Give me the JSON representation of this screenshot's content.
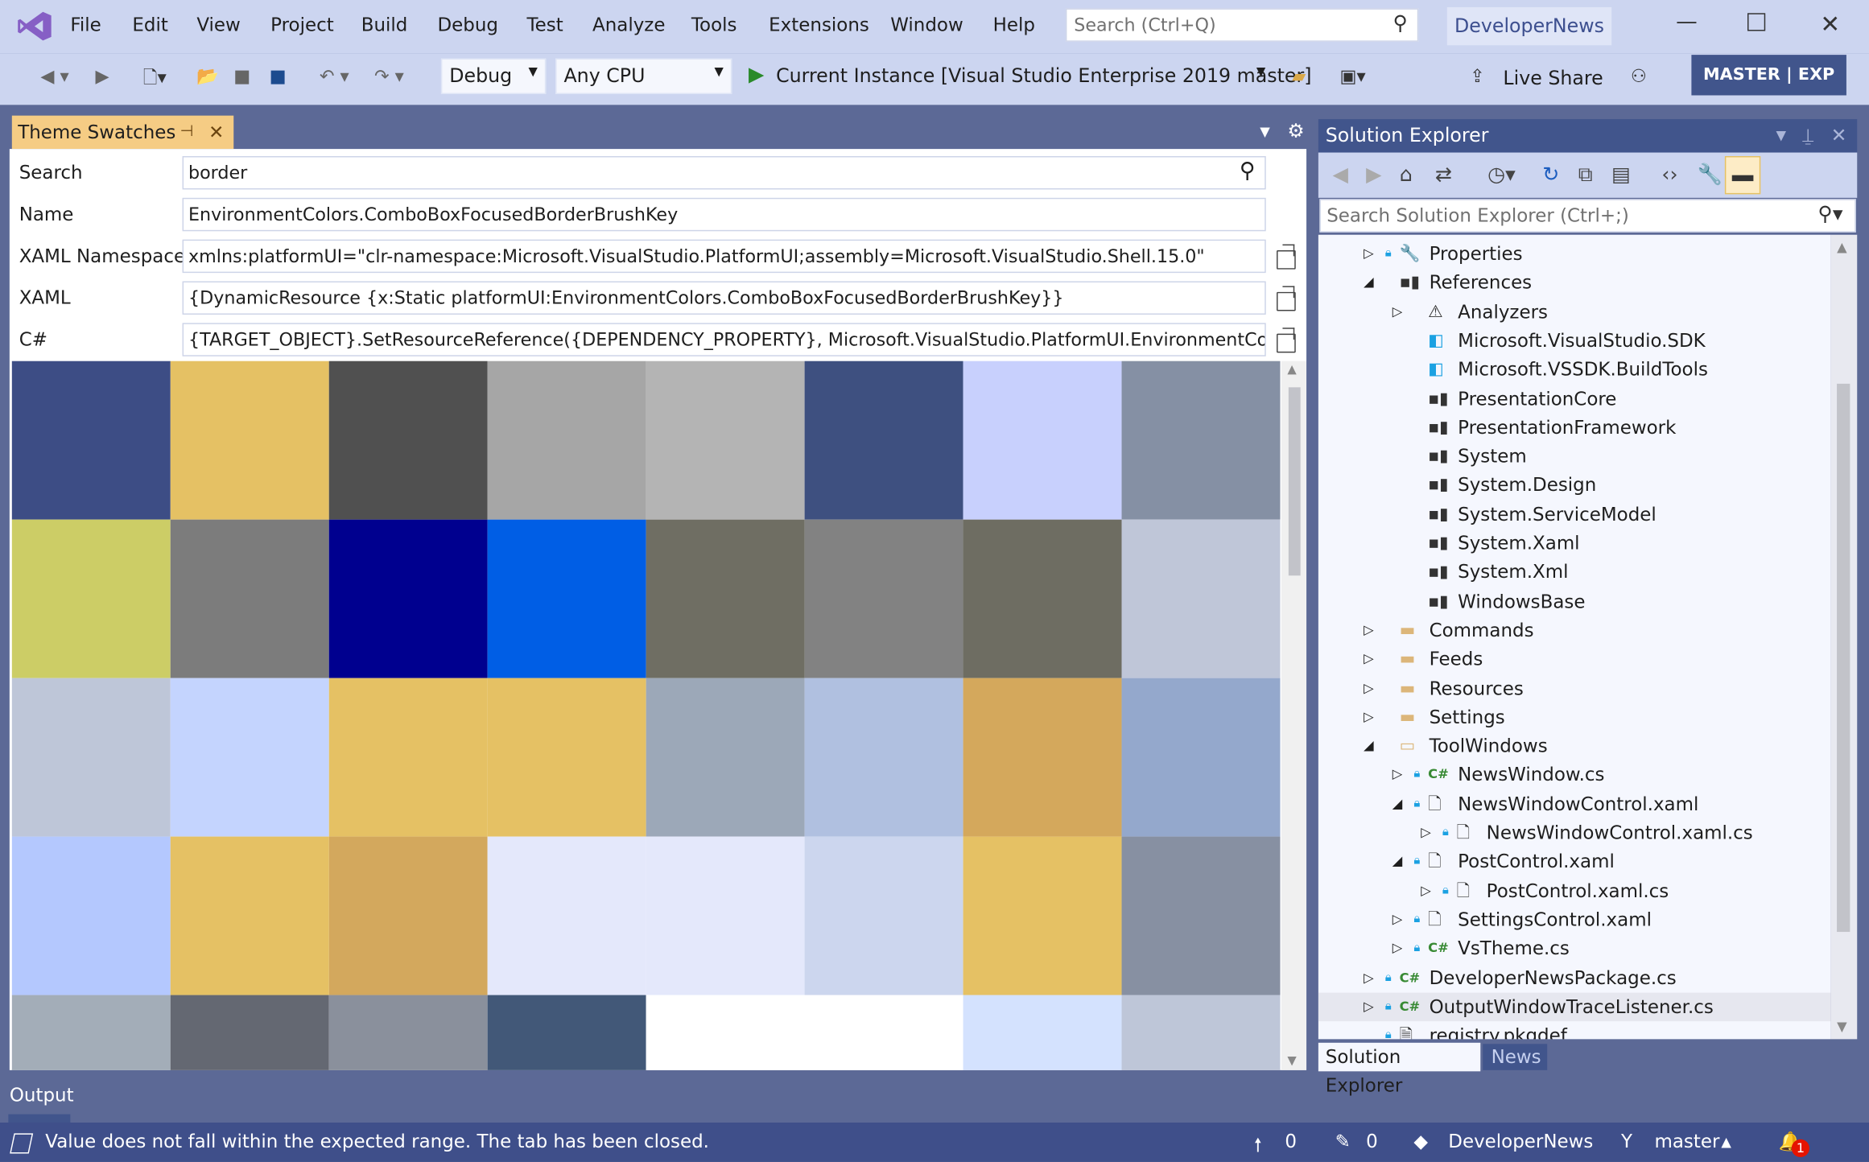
{
  "menu": [
    "File",
    "Edit",
    "View",
    "Project",
    "Build",
    "Debug",
    "Test",
    "Analyze",
    "Tools",
    "Extensions",
    "Window",
    "Help"
  ],
  "search_placeholder": "Search (Ctrl+Q)",
  "solution_name": "DeveloperNews",
  "toolbar": {
    "config": "Debug",
    "platform": "Any CPU",
    "run_target": "Current Instance [Visual Studio Enterprise 2019 master]",
    "live_share": "Live Share",
    "badge": "MASTER | EXP"
  },
  "theme_tab": {
    "title": "Theme Swatches"
  },
  "form": [
    {
      "label": "Search",
      "value": "border"
    },
    {
      "label": "Name",
      "value": "EnvironmentColors.ComboBoxFocusedBorderBrushKey"
    },
    {
      "label": "XAML Namespace",
      "value": "xmlns:platformUI=\"clr-namespace:Microsoft.VisualStudio.PlatformUI;assembly=Microsoft.VisualStudio.Shell.15.0\""
    },
    {
      "label": "XAML",
      "value": "{DynamicResource {x:Static platformUI:EnvironmentColors.ComboBoxFocusedBorderBrushKey}}"
    },
    {
      "label": "C#",
      "value": "{TARGET_OBJECT}.SetResourceReference({DEPENDENCY_PROPERTY}, Microsoft.VisualStudio.PlatformUI.EnvironmentColors.ComboBoxFocusedBorderBrushKey);"
    }
  ],
  "swatches": [
    [
      "#3d4d85",
      "#e5c164",
      "#505050",
      "#a6a6a6",
      "#b4b4b4",
      "#3e5080",
      "#c8d0fd",
      "#8590a4"
    ],
    [
      "#cccd66",
      "#7c7c7c",
      "#00008f",
      "#005ee5",
      "#6f6e63",
      "#828282",
      "#6e6d62",
      "#bfc6d8"
    ],
    [
      "#bec6d8",
      "#c4d4fe",
      "#e5c164",
      "#e5c164",
      "#9ca8b8",
      "#b0c0e0",
      "#d4a85c",
      "#94a8cc"
    ],
    [
      "#b4c8fe",
      "#e5c164",
      "#d3a85d",
      "#e4e8fb",
      "#e4e8fb",
      "#ccd6ee",
      "#e5c164",
      "#8790a2"
    ],
    [
      "#a3adb8",
      "#646872",
      "#8a909c",
      "#425878",
      "#ffffff",
      "#ffffff",
      "#d4e2fe",
      "#bec6d8"
    ]
  ],
  "solution_explorer": {
    "title": "Solution Explorer",
    "search_placeholder": "Search Solution Explorer (Ctrl+;)",
    "tree": [
      {
        "label": "Properties",
        "level": 0,
        "expander": "collapsed",
        "icon": "wrench-icon"
      },
      {
        "label": "References",
        "level": 0,
        "expander": "expanded",
        "icon": "references-icon"
      },
      {
        "label": "Analyzers",
        "level": 1,
        "expander": "collapsed",
        "icon": "analyzer-icon"
      },
      {
        "label": "Microsoft.VisualStudio.SDK",
        "level": 1,
        "expander": "none",
        "icon": "package-icon"
      },
      {
        "label": "Microsoft.VSSDK.BuildTools",
        "level": 1,
        "expander": "none",
        "icon": "package-icon"
      },
      {
        "label": "PresentationCore",
        "level": 1,
        "expander": "none",
        "icon": "reference-icon"
      },
      {
        "label": "PresentationFramework",
        "level": 1,
        "expander": "none",
        "icon": "reference-icon"
      },
      {
        "label": "System",
        "level": 1,
        "expander": "none",
        "icon": "reference-icon"
      },
      {
        "label": "System.Design",
        "level": 1,
        "expander": "none",
        "icon": "reference-icon"
      },
      {
        "label": "System.ServiceModel",
        "level": 1,
        "expander": "none",
        "icon": "reference-icon"
      },
      {
        "label": "System.Xaml",
        "level": 1,
        "expander": "none",
        "icon": "reference-icon"
      },
      {
        "label": "System.Xml",
        "level": 1,
        "expander": "none",
        "icon": "reference-icon"
      },
      {
        "label": "WindowsBase",
        "level": 1,
        "expander": "none",
        "icon": "reference-icon"
      },
      {
        "label": "Commands",
        "level": 0,
        "expander": "collapsed",
        "icon": "folder-icon"
      },
      {
        "label": "Feeds",
        "level": 0,
        "expander": "collapsed",
        "icon": "folder-icon"
      },
      {
        "label": "Resources",
        "level": 0,
        "expander": "collapsed",
        "icon": "folder-icon"
      },
      {
        "label": "Settings",
        "level": 0,
        "expander": "collapsed",
        "icon": "folder-icon"
      },
      {
        "label": "ToolWindows",
        "level": 0,
        "expander": "expanded",
        "icon": "folder-open-icon"
      },
      {
        "label": "NewsWindow.cs",
        "level": 1,
        "expander": "collapsed",
        "icon": "csharp-icon"
      },
      {
        "label": "NewsWindowControl.xaml",
        "level": 1,
        "expander": "expanded",
        "icon": "xaml-icon"
      },
      {
        "label": "NewsWindowControl.xaml.cs",
        "level": 2,
        "expander": "collapsed",
        "icon": "xaml-cs-icon"
      },
      {
        "label": "PostControl.xaml",
        "level": 1,
        "expander": "expanded",
        "icon": "xaml-icon"
      },
      {
        "label": "PostControl.xaml.cs",
        "level": 2,
        "expander": "collapsed",
        "icon": "xaml-cs-icon"
      },
      {
        "label": "SettingsControl.xaml",
        "level": 1,
        "expander": "collapsed",
        "icon": "xaml-icon"
      },
      {
        "label": "VsTheme.cs",
        "level": 1,
        "expander": "collapsed",
        "icon": "csharp-icon"
      },
      {
        "label": "DeveloperNewsPackage.cs",
        "level": 0,
        "expander": "collapsed",
        "icon": "csharp-icon"
      },
      {
        "label": "OutputWindowTraceListener.cs",
        "level": 0,
        "expander": "collapsed",
        "icon": "csharp-icon",
        "selected": true
      },
      {
        "label": "registry.pkgdef",
        "level": 0,
        "expander": "none",
        "icon": "pkgdef-icon"
      }
    ],
    "tabs": [
      "Solution Explorer",
      "News"
    ]
  },
  "output_label": "Output",
  "status": {
    "message": "Value does not fall within the expected range.  The tab has been closed.",
    "up_count": "0",
    "pending_count": "0",
    "repo": "DeveloperNews",
    "branch": "master",
    "notifications": "1"
  },
  "colors": {
    "accent": "#41558c",
    "background": "#5c6996",
    "chrome": "#ccd5f0",
    "active_tab": "#f5cc84",
    "status_bar": "#3f4f8a"
  }
}
